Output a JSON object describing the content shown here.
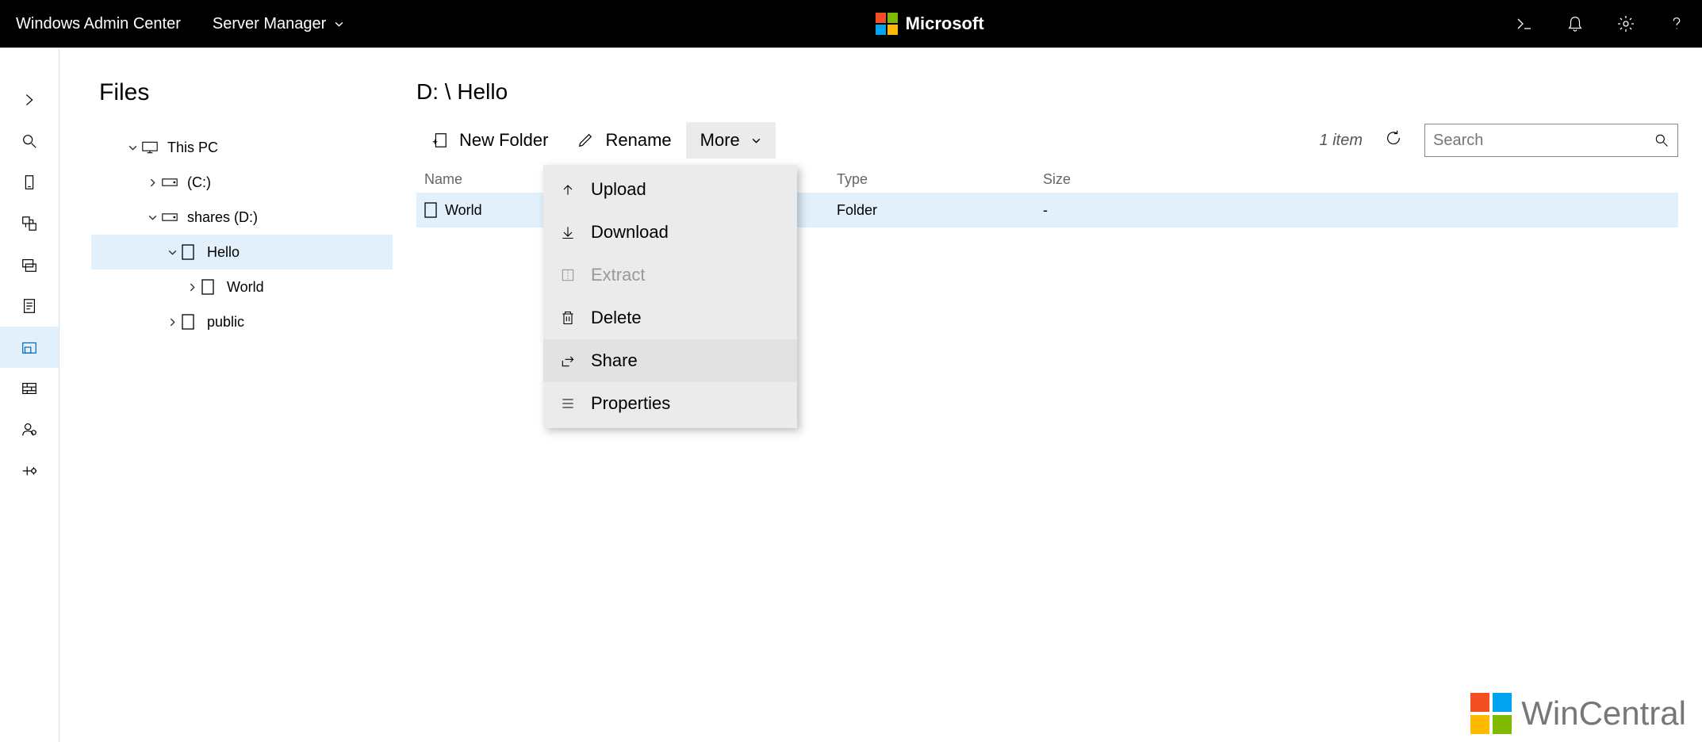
{
  "header": {
    "app_title": "Windows Admin Center",
    "server_menu_label": "Server Manager",
    "brand": "Microsoft"
  },
  "rail": {
    "items": [
      "expand",
      "search",
      "server",
      "replication",
      "storage",
      "document",
      "files",
      "firewall",
      "users",
      "services"
    ],
    "active_index": 6
  },
  "sidebar": {
    "title": "Files",
    "tree": [
      {
        "label": "This PC",
        "indent": 0,
        "expanded": true,
        "icon": "pc"
      },
      {
        "label": "(C:)",
        "indent": 1,
        "expanded": false,
        "icon": "drive"
      },
      {
        "label": "shares (D:)",
        "indent": 1,
        "expanded": true,
        "icon": "drive"
      },
      {
        "label": "Hello",
        "indent": 2,
        "expanded": true,
        "icon": "folder",
        "selected": true
      },
      {
        "label": "World",
        "indent": 3,
        "expanded": false,
        "icon": "folder"
      },
      {
        "label": "public",
        "indent": 2,
        "expanded": false,
        "icon": "folder"
      }
    ]
  },
  "content": {
    "breadcrumb": "D: \\ Hello",
    "toolbar": {
      "new_folder": "New Folder",
      "rename": "Rename",
      "more": "More"
    },
    "item_count": "1 item",
    "search_placeholder": "Search",
    "columns": {
      "name": "Name",
      "type": "Type",
      "size": "Size"
    },
    "rows": [
      {
        "name": "World",
        "type": "Folder",
        "size": "-",
        "selected": true
      }
    ],
    "more_menu": [
      {
        "label": "Upload",
        "icon": "upload",
        "enabled": true
      },
      {
        "label": "Download",
        "icon": "download",
        "enabled": true
      },
      {
        "label": "Extract",
        "icon": "extract",
        "enabled": false
      },
      {
        "label": "Delete",
        "icon": "delete",
        "enabled": true
      },
      {
        "label": "Share",
        "icon": "share",
        "enabled": true,
        "hover": true
      },
      {
        "label": "Properties",
        "icon": "properties",
        "enabled": true
      }
    ]
  },
  "watermark": "WinCentral"
}
